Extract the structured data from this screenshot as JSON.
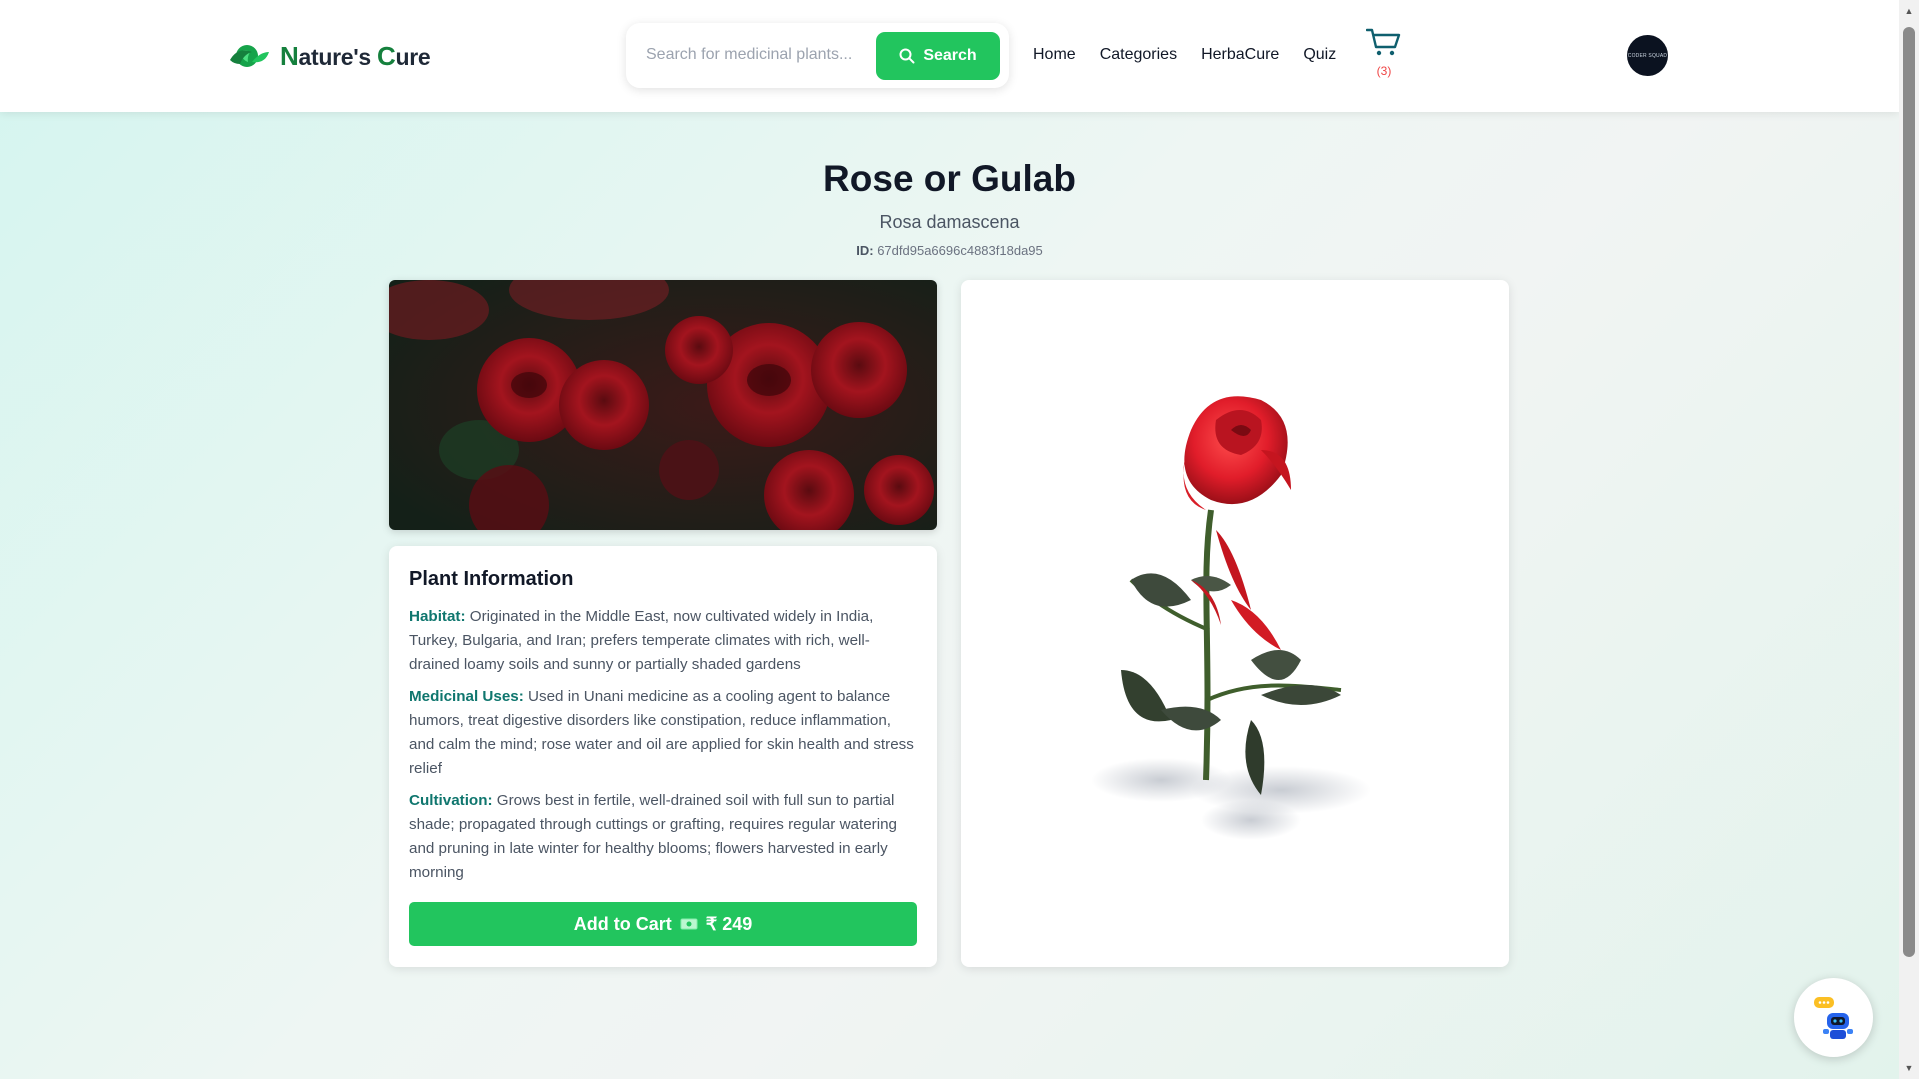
{
  "header": {
    "logo": {
      "text_n": "N",
      "text_mid1": "ature's ",
      "text_c": "C",
      "text_end": "ure",
      "icon": "leaf-globe-icon"
    },
    "search": {
      "placeholder": "Search for medicinal plants...",
      "button_label": "Search",
      "icon": "search-icon"
    },
    "nav": [
      "Home",
      "Categories",
      "HerbaCure",
      "Quiz"
    ],
    "cart": {
      "icon": "cart-icon",
      "count_label": "(3)"
    },
    "avatar": {
      "label": "CODER SQUAD"
    }
  },
  "plant": {
    "title": "Rose or Gulab",
    "scientific_name": "Rosa damascena",
    "id_label": "ID:",
    "id_value": "67dfd95a6696c4883f18da95"
  },
  "info": {
    "heading": "Plant Information",
    "habitat_label": "Habitat:",
    "habitat_text": "Originated in the Middle East, now cultivated widely in India, Turkey, Bulgaria, and Iran; prefers temperate climates with rich, well-drained loamy soils and sunny or partially shaded gardens",
    "uses_label": "Medicinal Uses:",
    "uses_text": "Used in Unani medicine as a cooling agent to balance humors, treat digestive disorders like constipation, reduce inflammation, and calm the mind; rose water and oil are applied for skin health and stress relief",
    "cultivation_label": "Cultivation:",
    "cultivation_text": "Grows best in fertile, well-drained soil with full sun to partial shade; propagated through cuttings or grafting, requires regular watering and pruning in late winter for healthy blooms; flowers harvested in early morning",
    "cart_button": {
      "label": "Add to Cart",
      "icon": "money-icon",
      "price": "₹ 249"
    }
  },
  "colors": {
    "brand_green": "#22c55e",
    "label_teal": "#0f766e",
    "cart_count_red": "#ef4444"
  },
  "chatbot": {
    "icon": "robot-chat-icon"
  }
}
